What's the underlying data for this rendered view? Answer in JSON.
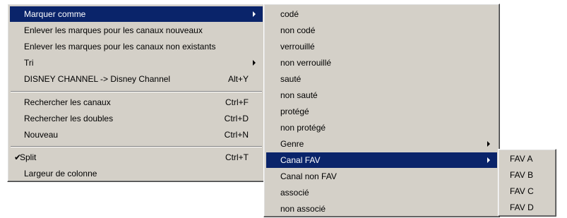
{
  "main_menu": {
    "items": [
      {
        "label": "Marquer comme",
        "shortcut": "",
        "submenu": true
      },
      {
        "label": "Enlever les marques pour les canaux nouveaux",
        "shortcut": ""
      },
      {
        "label": "Enlever les marques pour les canaux non existants",
        "shortcut": ""
      },
      {
        "label": "Tri",
        "shortcut": "",
        "submenu": true
      },
      {
        "label": "DISNEY CHANNEL -> Disney Channel",
        "shortcut": "Alt+Y"
      },
      {
        "label": "Rechercher les canaux",
        "shortcut": "Ctrl+F"
      },
      {
        "label": "Rechercher les doubles",
        "shortcut": "Ctrl+D"
      },
      {
        "label": "Nouveau",
        "shortcut": "Ctrl+N"
      },
      {
        "label": "Split",
        "shortcut": "Ctrl+T",
        "checked": true,
        "check_glyph": "✔"
      },
      {
        "label": "Largeur de colonne",
        "shortcut": ""
      }
    ]
  },
  "mark_submenu": {
    "items": [
      {
        "label": "codé"
      },
      {
        "label": "non codé"
      },
      {
        "label": "verrouillé"
      },
      {
        "label": "non verrouillé"
      },
      {
        "label": "sauté"
      },
      {
        "label": "non sauté"
      },
      {
        "label": "protégé"
      },
      {
        "label": "non protégé"
      },
      {
        "label": "Genre",
        "submenu": true
      },
      {
        "label": "Canal FAV",
        "submenu": true,
        "highlighted": true
      },
      {
        "label": "Canal non FAV"
      },
      {
        "label": "associé"
      },
      {
        "label": "non associé"
      }
    ]
  },
  "fav_submenu": {
    "items": [
      {
        "label": "FAV A"
      },
      {
        "label": "FAV B"
      },
      {
        "label": "FAV C"
      },
      {
        "label": "FAV D"
      }
    ]
  },
  "colors": {
    "menu_bg": "#d4d0c8",
    "highlight_bg": "#0a246a",
    "highlight_text": "#ffffff"
  }
}
